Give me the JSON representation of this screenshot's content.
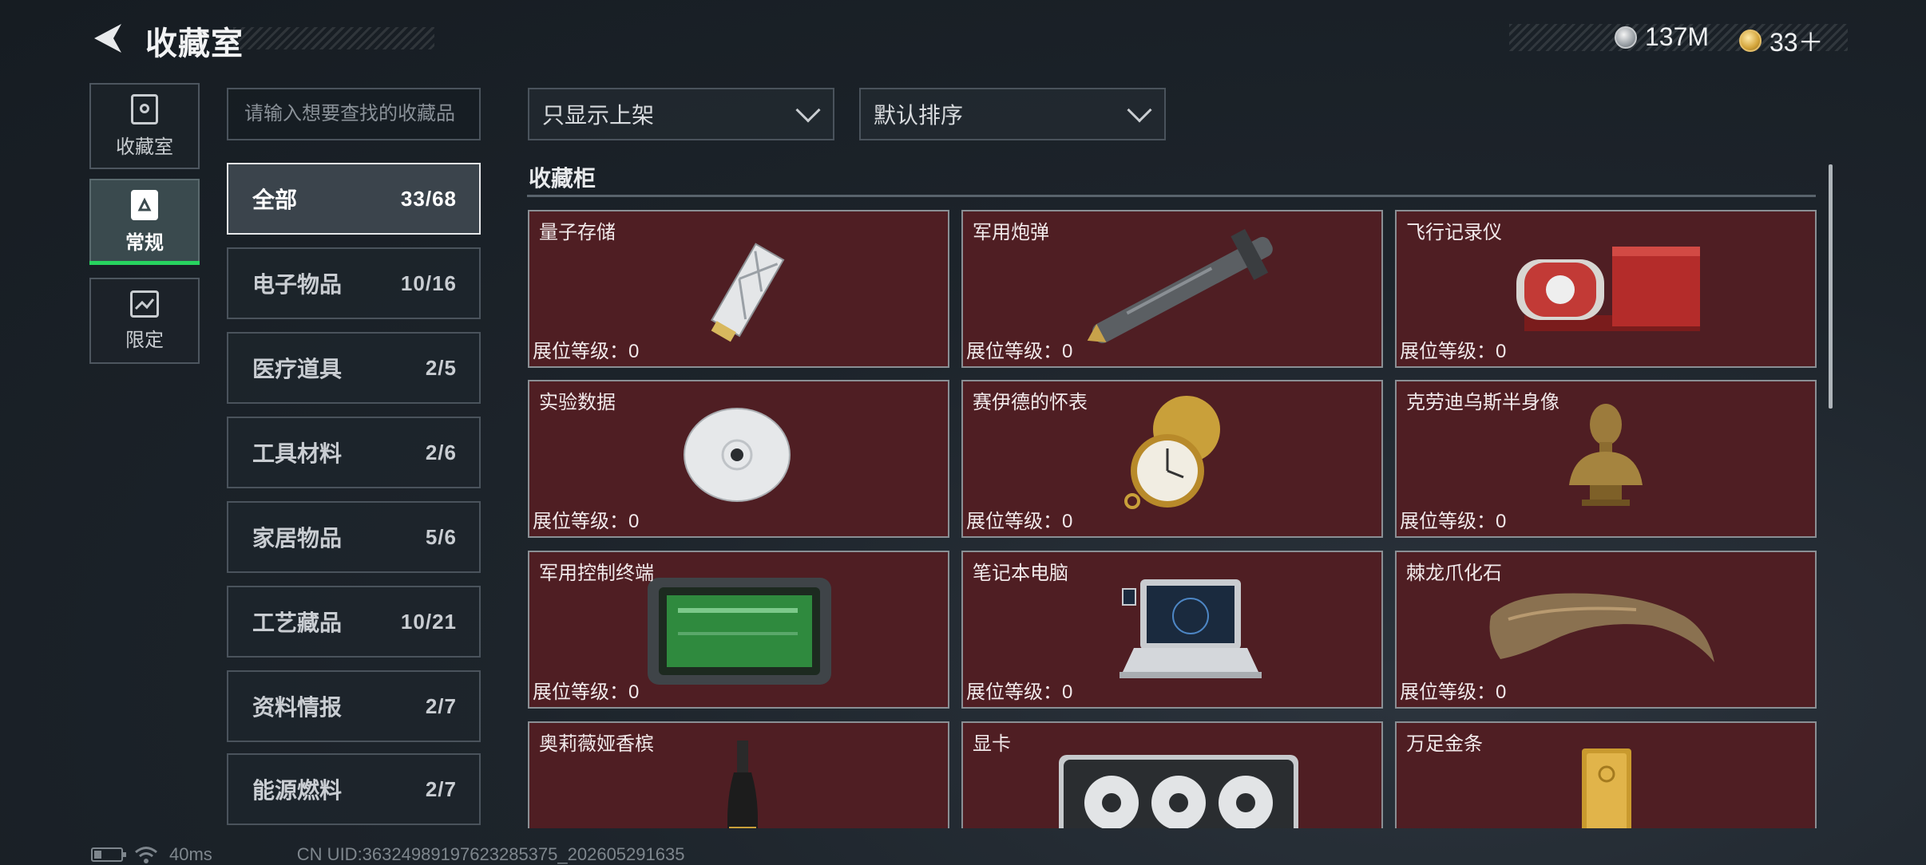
{
  "header": {
    "title": "收藏室"
  },
  "currency": {
    "silver": "137M",
    "gold": "33＋"
  },
  "nav": [
    {
      "label": "收藏室",
      "icon": "collection-room-icon",
      "active": false
    },
    {
      "label": "常规",
      "icon": "regular-icon",
      "active": true
    },
    {
      "label": "限定",
      "icon": "limited-icon",
      "active": false
    }
  ],
  "search": {
    "placeholder": "请输入想要查找的收藏品"
  },
  "categories": [
    {
      "name": "全部",
      "count": "33/68",
      "active": true
    },
    {
      "name": "电子物品",
      "count": "10/16"
    },
    {
      "name": "医疗道具",
      "count": "2/5"
    },
    {
      "name": "工具材料",
      "count": "2/6"
    },
    {
      "name": "家居物品",
      "count": "5/6"
    },
    {
      "name": "工艺藏品",
      "count": "10/21"
    },
    {
      "name": "资料情报",
      "count": "2/7"
    },
    {
      "name": "能源燃料",
      "count": "2/7"
    }
  ],
  "filters": {
    "filter_value": "只显示上架",
    "sort_value": "默认排序"
  },
  "section": {
    "title": "收藏柜"
  },
  "level_label": "展位等级：",
  "items": [
    {
      "name": "量子存储",
      "level": "0",
      "icon": "quantum-storage-icon"
    },
    {
      "name": "军用炮弹",
      "level": "0",
      "icon": "military-shell-icon"
    },
    {
      "name": "飞行记录仪",
      "level": "0",
      "icon": "flight-recorder-icon"
    },
    {
      "name": "实验数据",
      "level": "0",
      "icon": "disc-icon"
    },
    {
      "name": "赛伊德的怀表",
      "level": "0",
      "icon": "pocket-watch-icon"
    },
    {
      "name": "克劳迪乌斯半身像",
      "level": "0",
      "icon": "bust-icon"
    },
    {
      "name": "军用控制终端",
      "level": "0",
      "icon": "control-terminal-icon"
    },
    {
      "name": "笔记本电脑",
      "level": "0",
      "icon": "laptop-icon"
    },
    {
      "name": "棘龙爪化石",
      "level": "0",
      "icon": "claw-fossil-icon"
    },
    {
      "name": "奥莉薇娅香槟",
      "level": "",
      "icon": "champagne-icon"
    },
    {
      "name": "显卡",
      "level": "",
      "icon": "graphics-card-icon"
    },
    {
      "name": "万足金条",
      "level": "",
      "icon": "gold-bar-icon"
    }
  ],
  "status": {
    "ping": "40ms",
    "uid": "CN UID:36324989197623285375_202605291635",
    "battery_level": 0.25
  }
}
